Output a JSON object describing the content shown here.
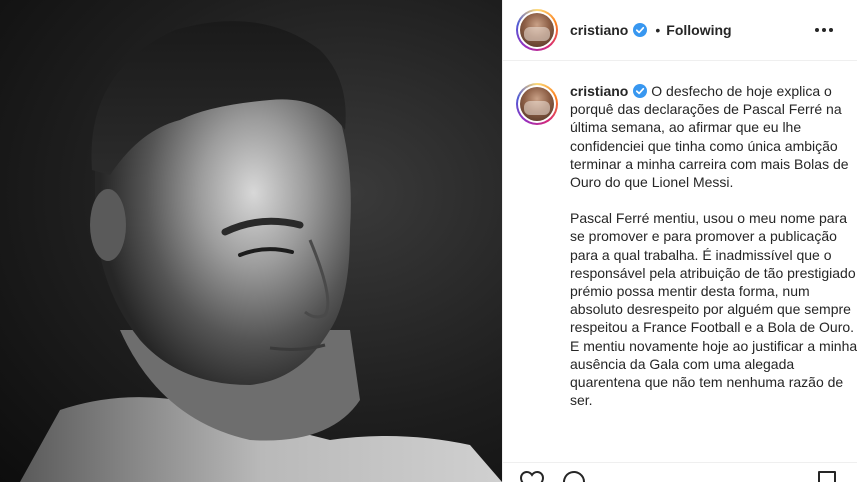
{
  "post": {
    "username": "cristiano",
    "separator": "•",
    "follow_status": "Following",
    "verified": true
  },
  "caption": {
    "username": "cristiano",
    "paragraphs": [
      "O desfecho de hoje explica o porquê das declarações de Pascal Ferré na última semana, ao afirmar que eu lhe confidenciei que tinha como única ambição terminar a minha carreira com mais Bolas de Ouro do que Lionel Messi.",
      "Pascal Ferré mentiu, usou o meu nome para se promover e para promover a publicação para a qual trabalha. É inadmissível que o responsável pela atribuição de tão prestigiado prémio possa mentir desta forma, num absoluto desrespeito por alguém que sempre respeitou a France Football e a Bola de Ouro. E mentiu novamente hoje ao justificar a minha ausência da Gala com uma alegada quarentena que não tem nenhuma razão de ser."
    ]
  },
  "icons": {
    "verified": "verified-badge-icon",
    "more": "more-options-icon",
    "like": "heart-icon",
    "comment": "comment-icon",
    "save": "bookmark-icon"
  },
  "colors": {
    "verified_blue": "#3897f0",
    "text": "#262626",
    "divider": "#efefef"
  }
}
